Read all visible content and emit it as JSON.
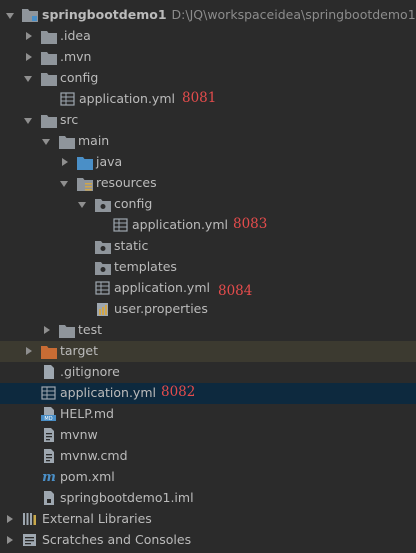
{
  "root": {
    "name": "springbootdemo1",
    "path": "D:\\JQ\\workspaceidea\\springbootdemo1"
  },
  "items": {
    "idea": ".idea",
    "mvn": ".mvn",
    "config": "config",
    "config_yml": "application.yml",
    "src": "src",
    "main": "main",
    "java": "java",
    "resources": "resources",
    "res_config": "config",
    "res_config_yml": "application.yml",
    "static": "static",
    "templates": "templates",
    "res_yml": "application.yml",
    "user_props": "user.properties",
    "test": "test",
    "target": "target",
    "gitignore": ".gitignore",
    "root_yml": "application.yml",
    "help": "HELP.md",
    "mvnw": "mvnw",
    "mvnw_cmd": "mvnw.cmd",
    "pom": "pom.xml",
    "iml": "springbootdemo1.iml",
    "external_libraries": "External Libraries",
    "scratches": "Scratches and Consoles"
  },
  "annotations": {
    "config_port": "8081",
    "root_port": "8082",
    "res_config_port": "8083",
    "res_port": "8084"
  },
  "colors": {
    "background": "#2b2b2b",
    "text": "#bbbbbb",
    "annotation": "#e44c4c",
    "folder": "#8f959b",
    "source_folder": "#4a8fc7",
    "excluded_folder": "#c86c34",
    "selected_row": "#0d293e",
    "excluded_row": "#3c3a30"
  }
}
